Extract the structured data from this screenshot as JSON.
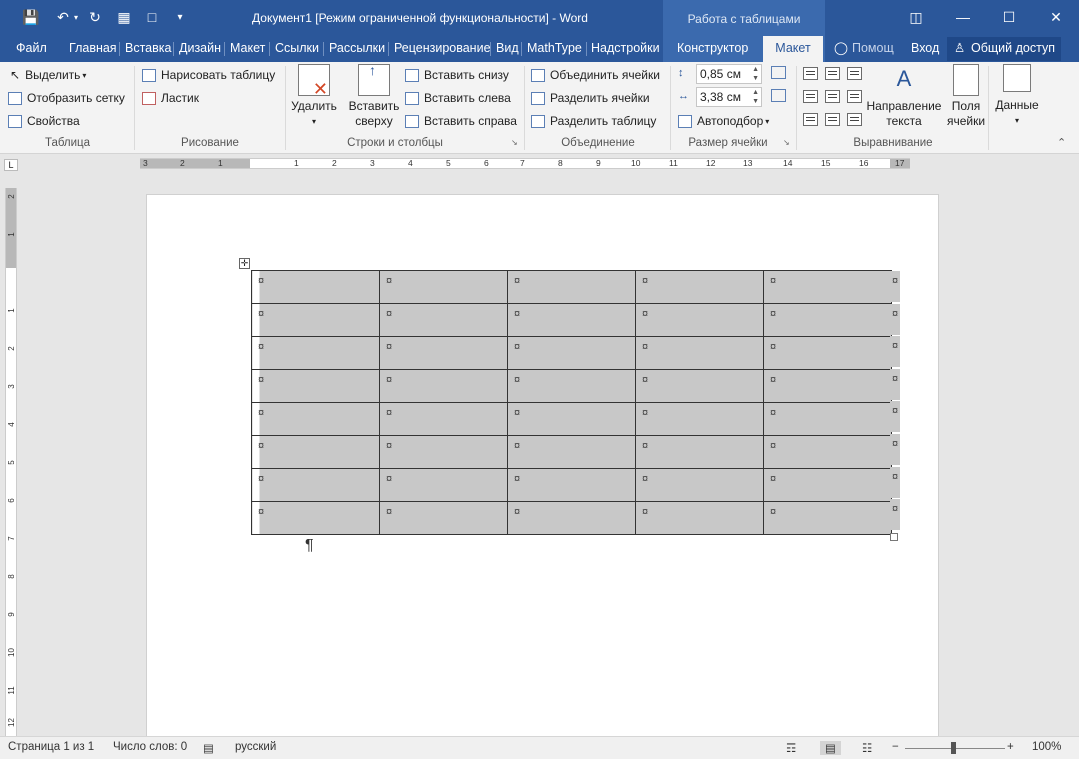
{
  "window": {
    "title": "Документ1 [Режим ограниченной функциональности] - Word",
    "context_title": "Работа с таблицами"
  },
  "tabs": [
    {
      "label": "Файл"
    },
    {
      "label": "Главная"
    },
    {
      "label": "Вставка"
    },
    {
      "label": "Дизайн"
    },
    {
      "label": "Макет"
    },
    {
      "label": "Ссылки"
    },
    {
      "label": "Рассылки"
    },
    {
      "label": "Рецензирование"
    },
    {
      "label": "Вид"
    },
    {
      "label": "MathType"
    },
    {
      "label": "Надстройки"
    },
    {
      "label": "Конструктор"
    }
  ],
  "active_tab": "Макет",
  "tell_me": "Помощ",
  "signin": "Вход",
  "share": "Общий доступ",
  "ribbon": {
    "table": {
      "select": "Выделить",
      "gridlines": "Отобразить сетку",
      "properties": "Свойства",
      "label": "Таблица"
    },
    "draw": {
      "draw_table": "Нарисовать таблицу",
      "eraser": "Ластик",
      "label": "Рисование"
    },
    "rows_cols": {
      "delete": "Удалить",
      "insert_above_1": "Вставить",
      "insert_above_2": "сверху",
      "insert_below": "Вставить снизу",
      "insert_left": "Вставить слева",
      "insert_right": "Вставить справа",
      "label": "Строки и столбцы"
    },
    "merge": {
      "merge_cells": "Объединить ячейки",
      "split_cells": "Разделить ячейки",
      "split_table": "Разделить таблицу",
      "label": "Объединение"
    },
    "cell_size": {
      "height": "0,85 см",
      "width": "3,38 см",
      "autofit": "Автоподбор",
      "label": "Размер ячейки"
    },
    "alignment": {
      "direction_1": "Направление",
      "direction_2": "текста",
      "margins_1": "Поля",
      "margins_2": "ячейки",
      "label": "Выравнивание"
    },
    "data": {
      "label": "Данные"
    }
  },
  "ruler": {
    "h_ticks": [
      "3",
      "2",
      "1",
      "1",
      "2",
      "3",
      "4",
      "5",
      "6",
      "7",
      "8",
      "9",
      "10",
      "11",
      "12",
      "13",
      "14",
      "15",
      "16",
      "17"
    ],
    "v_ticks": [
      "2",
      "1",
      "1",
      "2",
      "3",
      "4",
      "5",
      "6",
      "7",
      "8",
      "9",
      "10",
      "11",
      "12"
    ]
  },
  "document": {
    "cell_mark": "¤",
    "para_mark": "¶",
    "rows": 8,
    "cols": 5
  },
  "status": {
    "page": "Страница 1 из 1",
    "words": "Число слов: 0",
    "language": "русский",
    "zoom": "100%"
  }
}
